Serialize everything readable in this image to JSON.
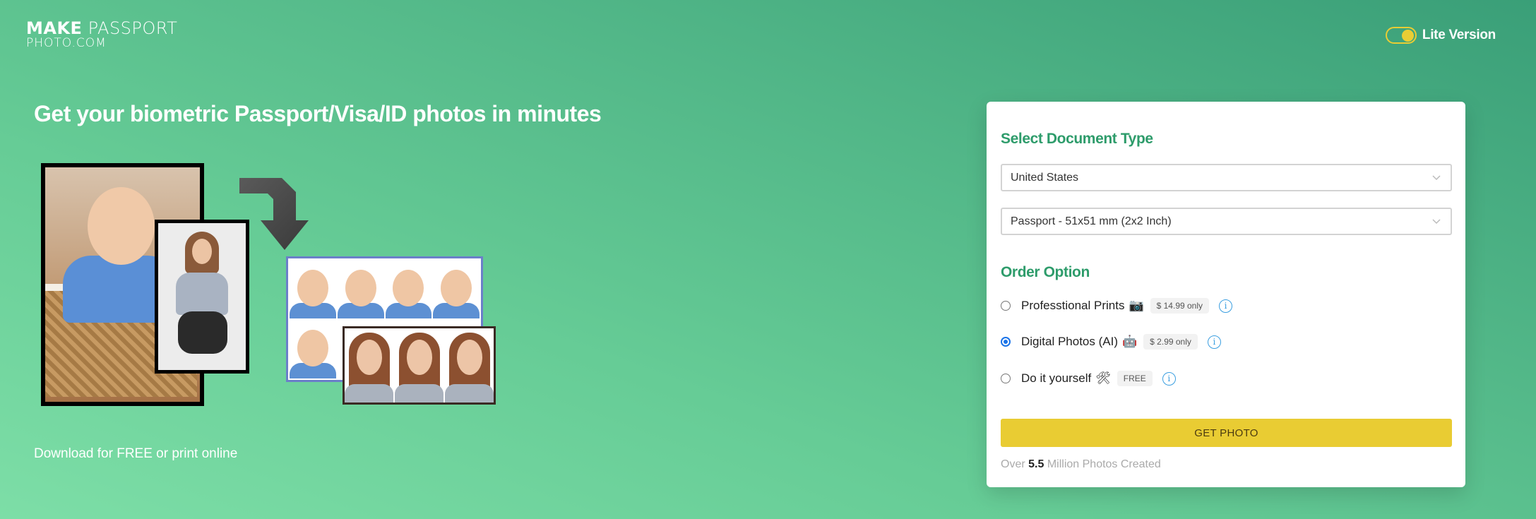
{
  "header": {
    "logo_line1_bold": "MAKE",
    "logo_line1_light": "PASSPORT",
    "logo_line2": "PHOTO.COM",
    "lite_toggle_label": "Lite Version",
    "lite_toggle_on": true
  },
  "hero": {
    "headline": "Get your biometric Passport/Visa/ID photos in minutes",
    "subline": "Download for FREE or print online",
    "illustration_alt": "Before/after passport photo conversion illustration"
  },
  "form": {
    "document_section_title": "Select Document Type",
    "country_select": {
      "value": "United States"
    },
    "document_select": {
      "value": "Passport - 51x51 mm (2x2 Inch)"
    },
    "order_section_title": "Order Option",
    "options": [
      {
        "label": "Professtional Prints",
        "emoji": "📷",
        "emoji_name": "camera-icon",
        "price": "$ 14.99 only",
        "checked": false
      },
      {
        "label": "Digital Photos (AI)",
        "emoji": "🤖",
        "emoji_name": "robot-icon",
        "price": "$ 2.99 only",
        "checked": true
      },
      {
        "label": "Do it yourself",
        "emoji": "🛠",
        "emoji_name": "tools-icon",
        "price": "FREE",
        "checked": false
      }
    ],
    "info_glyph": "i",
    "cta_label": "GET PHOTO",
    "stat_prefix": "Over",
    "stat_value": "5.5",
    "stat_suffix": "Million Photos Created"
  },
  "colors": {
    "accent_green": "#2e9c6b",
    "cta_yellow": "#e9cc33",
    "radio_blue": "#1a73e8",
    "info_blue": "#3a9ee0",
    "bg_gradient_start": "#7ddea7",
    "bg_gradient_end": "#3a9f78"
  }
}
